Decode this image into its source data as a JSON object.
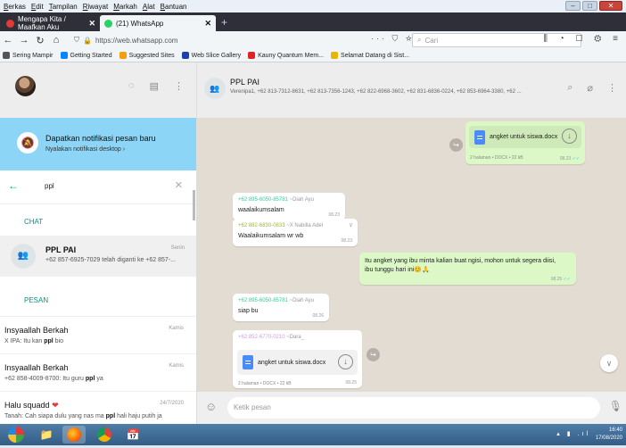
{
  "menu": [
    "Berkas",
    "Edit",
    "Tampilan",
    "Riwayat",
    "Markah",
    "Alat",
    "Bantuan"
  ],
  "tabs": [
    {
      "label": "Mengapa Kita / Maafkan Aku",
      "icon": "youtube-icon",
      "color": "#e53935"
    },
    {
      "label": "(21) WhatsApp",
      "icon": "whatsapp-icon",
      "color": "#25d366"
    }
  ],
  "url": "https://web.whatsapp.com",
  "search_placeholder": "Cari",
  "bookmarks": [
    {
      "label": "Sering Mampir",
      "color": "#555"
    },
    {
      "label": "Getting Started",
      "color": "#0a84ff"
    },
    {
      "label": "Suggested Sites",
      "color": "#f59e0b"
    },
    {
      "label": "Web Slice Gallery",
      "color": "#1e40af"
    },
    {
      "label": "Kauny Quantum Mem...",
      "color": "#dc2626"
    },
    {
      "label": "Selamat Datang di Sist...",
      "color": "#eab308"
    }
  ],
  "notification": {
    "title": "Dapatkan notifikasi pesan baru",
    "subtitle": "Nyalakan notifikasi desktop ›"
  },
  "search_value": "ppl",
  "chat_section": "CHAT",
  "chat_result": {
    "name": "PPL PAI",
    "time": "Senin",
    "message": "+62 857-6925-7029 telah diganti ke +62 857-..."
  },
  "pesan_section": "PESAN",
  "messages": [
    {
      "name": "Insyaallah Berkah",
      "time": "Kamis",
      "before": "X IPA: Itu kan ",
      "match": "ppl",
      "after": " bio"
    },
    {
      "name": "Insyaallah Berkah",
      "time": "Kamis",
      "before": "+62 858-4009-8700: Itu guru ",
      "match": "ppl",
      "after": " ya"
    },
    {
      "name": "Halu squadd",
      "time": "24/7/2020",
      "before": "Tanah: Cah siapa dulu yang nas ma ",
      "match": "ppl",
      "after": " hali haju putih ja"
    }
  ],
  "chat_header": {
    "name": "PPL PAI",
    "members": "Verenipa1, +62 813-7312-8631, +62 813-7356-1243, +62 822-6968-3602, +62 831-6836-0224, +62 853-6964-3380, +62 ..."
  },
  "conversation": {
    "doc1": {
      "name": "angket untuk siswa.docx",
      "meta": "2 halaman • DOCX • 22 kB",
      "time": "08.23"
    },
    "m1": {
      "sender": "+62 895-6050-85781",
      "alias": "~Diah Ayu",
      "text": "waalaikumsalam",
      "time": "08.23"
    },
    "m2": {
      "sender": "+62 882-6830-0833",
      "alias": "~X Nabilla Adel",
      "text": "Waalaikumsalam wr wb",
      "time": "08.23"
    },
    "m3": {
      "text": "Itu angket yang ibu minta kalian buat ngisi, mohon untuk segera diisi, ibu tunggu hari ini",
      "time": "08.25"
    },
    "m4": {
      "sender": "+62 895-6050-85781",
      "alias": "~Diah Ayu",
      "text": "siap bu",
      "time": "08.26"
    },
    "m5": {
      "sender": "+62 852-6770-0210",
      "alias": "~Dara_",
      "doc": "angket untuk siswa.docx",
      "meta": "2 halaman • DOCX • 22 kB",
      "time": "08.25"
    }
  },
  "composer_placeholder": "Ketik pesan",
  "clock": {
    "time": "16:40",
    "date": "17/08/2020"
  }
}
